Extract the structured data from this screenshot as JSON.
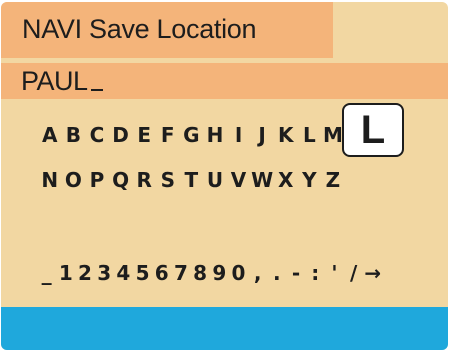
{
  "title": "NAVI Save Location",
  "entry": {
    "value": "PAUL"
  },
  "keyboard": {
    "row1": [
      "A",
      "B",
      "C",
      "D",
      "E",
      "F",
      "G",
      "H",
      "I",
      "J",
      "K",
      "L",
      "M"
    ],
    "row2": [
      "N",
      "O",
      "P",
      "Q",
      "R",
      "S",
      "T",
      "U",
      "V",
      "W",
      "X",
      "Y",
      "Z"
    ],
    "row3": [
      "_",
      "1",
      "2",
      "3",
      "4",
      "5",
      "6",
      "7",
      "8",
      "9",
      "0",
      ",",
      ".",
      "-",
      ":",
      "'",
      "/",
      "→"
    ],
    "highlighted_key": "L"
  },
  "colors": {
    "background": "#f2d7a2",
    "bar": "#f4b47a",
    "bottom_bar": "#1fa8dc"
  }
}
